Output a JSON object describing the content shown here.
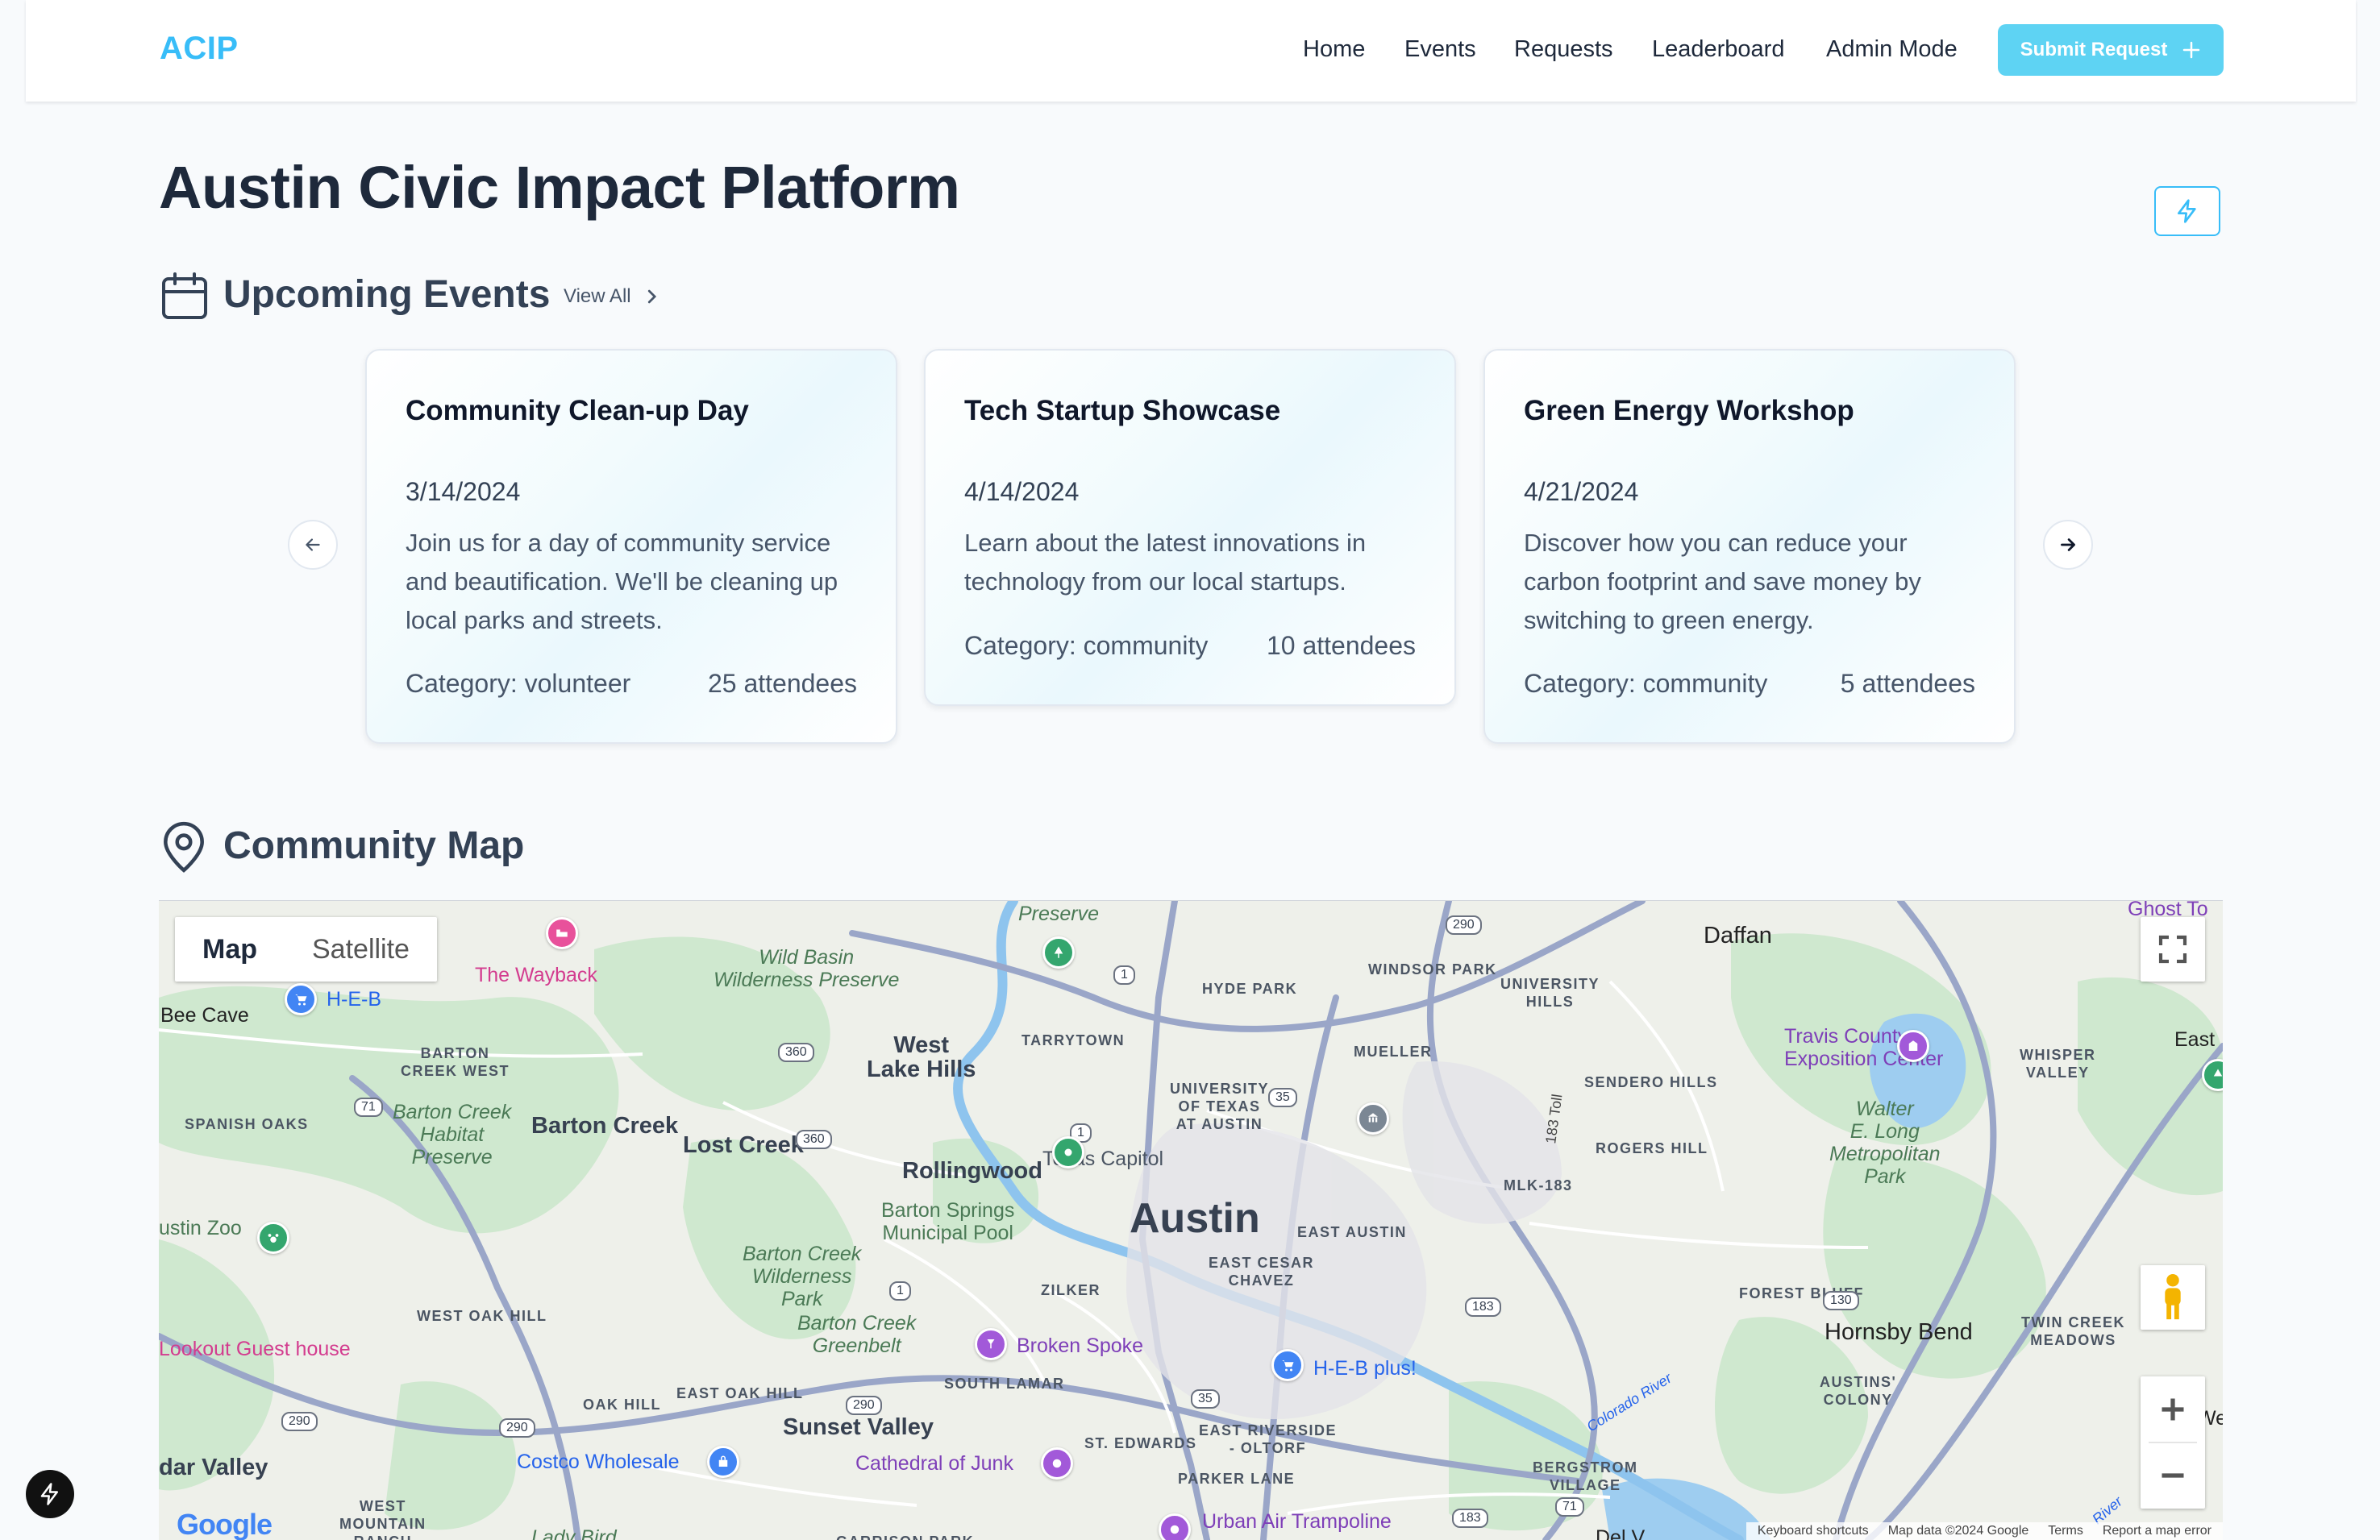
{
  "app": {
    "logo": "ACIP"
  },
  "nav": {
    "items": [
      {
        "label": "Home"
      },
      {
        "label": "Events"
      },
      {
        "label": "Requests"
      },
      {
        "label": "Leaderboard"
      },
      {
        "label": "Admin Mode"
      }
    ],
    "submit_label": "Submit Request"
  },
  "page": {
    "title": "Austin Civic Impact Platform"
  },
  "events": {
    "heading": "Upcoming Events",
    "view_all": "View All",
    "cards": [
      {
        "title": "Community Clean-up Day",
        "date": "3/14/2024",
        "description": "Join us for a day of community service and beautification. We'll be cleaning up local parks and streets.",
        "category": "Category: volunteer",
        "attendees": "25 attendees"
      },
      {
        "title": "Tech Startup Showcase",
        "date": "4/14/2024",
        "description": "Learn about the latest innovations in technology from our local startups.",
        "category": "Category: community",
        "attendees": "10 attendees"
      },
      {
        "title": "Green Energy Workshop",
        "date": "4/21/2024",
        "description": "Discover how you can reduce your carbon footprint and save money by switching to green energy.",
        "category": "Category: community",
        "attendees": "5 attendees"
      }
    ]
  },
  "map": {
    "heading": "Community Map",
    "type_map": "Map",
    "type_satellite": "Satellite",
    "center_label": "Austin",
    "labels": {
      "bee_cave": "Bee Cave",
      "heb": "H-E-B",
      "the_wayback": "The Wayback",
      "wild_basin": "Wild Basin\nWilderness Preserve",
      "metropolitan_park": "Metropolitan\nPark",
      "nature_preserve": "Preserve",
      "daffan": "Daffan",
      "ghost_town": "Ghost To",
      "windsor_park": "WINDSOR PARK",
      "hyde_park": "HYDE PARK",
      "university_hills": "UNIVERSITY\nHILLS",
      "tarrytown": "TARRYTOWN",
      "west_lake_hills": "West\nLake Hills",
      "barton_creek_west": "BARTON\nCREEK WEST",
      "mueller": "MUELLER",
      "travis_county": "Travis County\nExposition Center",
      "whisper_valley": "WHISPER\nVALLEY",
      "east": "East",
      "spanish_oaks": "SPANISH OAKS",
      "barton_creek_habitat": "Barton Creek\nHabitat\nPreserve",
      "barton_creek": "Barton Creek",
      "lost_creek": "Lost Creek",
      "ut_austin": "UNIVERSITY\nOF TEXAS\nAT AUSTIN",
      "sendero_hills": "SENDERO HILLS",
      "walter_long": "Walter\nE. Long\nMetropolitan\nPark",
      "rollingwood": "Rollingwood",
      "texas_capitol": "Texas Capitol",
      "rogers_hill": "ROGERS HILL",
      "austin_zoo": "ustin Zoo",
      "barton_springs": "Barton Springs\nMunicipal Pool",
      "mlk_183": "MLK-183",
      "east_austin": "EAST AUSTIN",
      "east_cesar_chavez": "EAST CESAR\nCHAVEZ",
      "barton_creek_wilderness": "Barton Creek\nWilderness\nPark",
      "zilker": "ZILKER",
      "forest_bluff": "FOREST BLUFF",
      "twin_creek_meadows": "TWIN CREEK\nMEADOWS",
      "west_oak_hill": "WEST OAK HILL",
      "barton_creek_greenbelt": "Barton Creek\nGreenbelt",
      "hornsby_bend": "Hornsby Bend",
      "lookout_guest_house": "Lookout Guest house",
      "broken_spoke": "Broken Spoke",
      "heb_plus": "H-E-B plus!",
      "south_lamar": "SOUTH LAMAR",
      "austins_colony": "AUSTINS'\nCOLONY",
      "colorado_river": "Colorado River",
      "east_oak_hill": "EAST OAK HILL",
      "oak_hill": "OAK HILL",
      "sunset_valley": "Sunset Valley",
      "dar_valley": "dar Valley",
      "costco": "Costco Wholesale",
      "cathedral_of_junk": "Cathedral of Junk",
      "st_edwards": "ST. EDWARDS",
      "east_riverside": "EAST RIVERSIDE\n- OLTORF",
      "bergstrom_village": "BERGSTROM\nVILLAGE",
      "parker_lane": "PARKER LANE",
      "west_mountain_ranch": "WEST\nMOUNTAIN\nRANCH",
      "urban_air": "Urban Air Trampoline",
      "lady_bird": "Lady Bird",
      "garrison_park": "GARRISON PARK",
      "del_v": "Del V",
      "we": "We",
      "toll": "183 Toll",
      "colorado_river_2": "River"
    },
    "shields": [
      "290",
      "1",
      "360",
      "71",
      "360",
      "1",
      "35",
      "1",
      "183",
      "130",
      "290",
      "290",
      "35",
      "290",
      "183",
      "71"
    ],
    "attribution": {
      "shortcuts": "Keyboard shortcuts",
      "data": "Map data ©2024 Google",
      "terms": "Terms",
      "report": "Report a map error"
    },
    "google": "Google"
  },
  "colors": {
    "accent": "#38bdf8",
    "submit_button": "#5ed3f3",
    "heading": "#1e293b",
    "background": "#f8fafc"
  },
  "icons": {
    "section_events": "calendar-icon",
    "section_map": "map-pin-icon",
    "bolt": "bolt-icon",
    "plus": "plus-icon",
    "prev": "arrow-left-icon",
    "next": "arrow-right-icon"
  }
}
